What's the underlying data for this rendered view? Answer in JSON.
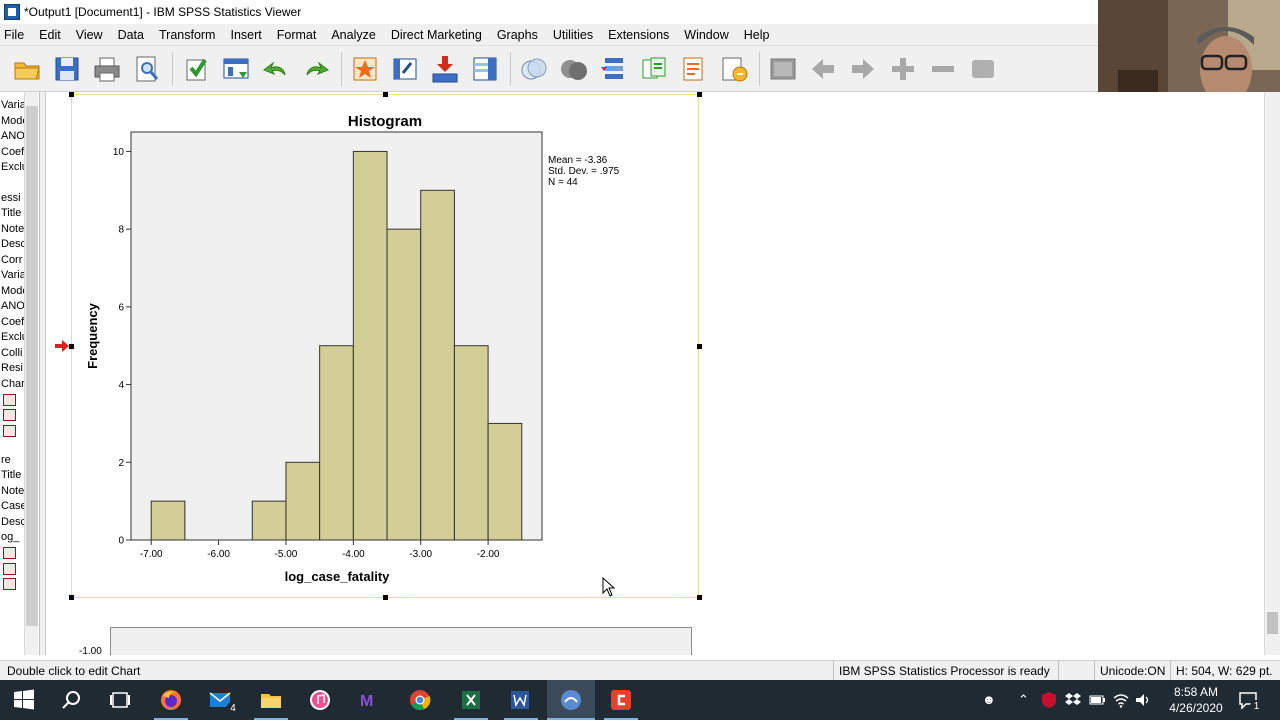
{
  "window": {
    "title": "*Output1 [Document1] - IBM SPSS Statistics Viewer"
  },
  "menu": [
    "File",
    "Edit",
    "View",
    "Data",
    "Transform",
    "Insert",
    "Format",
    "Analyze",
    "Direct Marketing",
    "Graphs",
    "Utilities",
    "Extensions",
    "Window",
    "Help"
  ],
  "toolbar_icons": [
    "open-icon",
    "save-icon",
    "print-icon",
    "print-preview-icon",
    "export-icon",
    "goto-data-icon",
    "undo-icon",
    "redo-icon",
    "goto-case-icon",
    "goto-variable-icon",
    "insert-cases-icon",
    "variables-icon",
    "split-file-icon",
    "weight-cases-icon",
    "select-cases-icon",
    "value-labels-icon",
    "use-sets-icon",
    "edit-icon",
    "designate-window-icon",
    "back-icon",
    "forward-icon",
    "expand-icon",
    "collapse-icon",
    "show-icon"
  ],
  "outline": {
    "items_group1": [
      "Varia",
      "Mode",
      "ANO",
      "Coef",
      "Exclu"
    ],
    "items_group2": [
      "essi",
      "Title",
      "Note",
      "Desc",
      "Corr",
      "Varia",
      "Mode",
      "ANO",
      "Coef",
      "Exclu",
      "Colli",
      "Resi",
      "Char"
    ],
    "items_group3": [
      "re",
      "Title",
      "Note",
      "Case",
      "Desc",
      "og_"
    ]
  },
  "chart_data": {
    "type": "bar",
    "title": "Histogram",
    "xlabel": "log_case_fatality",
    "ylabel": "Frequency",
    "bin_width": 0.5,
    "bins": [
      {
        "start": -7.0,
        "count": 1
      },
      {
        "start": -6.5,
        "count": 0
      },
      {
        "start": -6.0,
        "count": 0
      },
      {
        "start": -5.5,
        "count": 1
      },
      {
        "start": -5.0,
        "count": 2
      },
      {
        "start": -4.5,
        "count": 5
      },
      {
        "start": -4.0,
        "count": 10
      },
      {
        "start": -3.5,
        "count": 8
      },
      {
        "start": -3.0,
        "count": 9
      },
      {
        "start": -2.5,
        "count": 5
      },
      {
        "start": -2.0,
        "count": 3
      }
    ],
    "xticks": [
      "-7.00",
      "-6.00",
      "-5.00",
      "-4.00",
      "-3.00",
      "-2.00"
    ],
    "xtick_values": [
      -7,
      -6,
      -5,
      -4,
      -3,
      -2
    ],
    "yticks": [
      "0",
      "2",
      "4",
      "6",
      "8",
      "10"
    ],
    "ytick_values": [
      0,
      2,
      4,
      6,
      8,
      10
    ],
    "xlim": [
      -7.3,
      -1.2
    ],
    "ylim": [
      0,
      10.5
    ],
    "stats": [
      "Mean = -3.36",
      "Std. Dev. = .975",
      "N = 44"
    ],
    "bar_color": "#d3cd96",
    "plot_bg": "#f0f0f0"
  },
  "next_chart": {
    "first_tick": "-1.00"
  },
  "statusbar": {
    "hint": "Double click to edit Chart",
    "processor": "IBM SPSS Statistics Processor is ready",
    "unicode": "Unicode:ON",
    "size": "H: 504, W: 629 pt."
  },
  "taskbar": {
    "mail_badge": "4",
    "time": "8:58 AM",
    "date": "4/26/2020",
    "notification_badge": "1"
  }
}
